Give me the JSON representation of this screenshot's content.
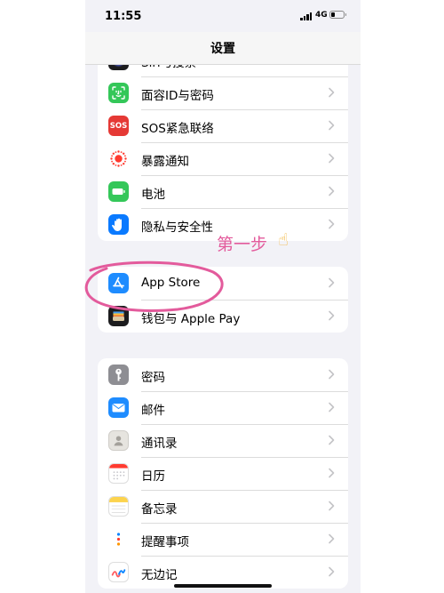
{
  "status": {
    "time": "11:55",
    "network": "4G"
  },
  "nav": {
    "title": "设置"
  },
  "group1": {
    "items": [
      {
        "label": "Siri与搜索"
      },
      {
        "label": "面容ID与密码"
      },
      {
        "label": "SOS紧急联络",
        "icon_text": "SOS"
      },
      {
        "label": "暴露通知"
      },
      {
        "label": "电池"
      },
      {
        "label": "隐私与安全性"
      }
    ]
  },
  "group2": {
    "items": [
      {
        "label": "App Store"
      },
      {
        "label": "钱包与 Apple Pay"
      }
    ]
  },
  "group3": {
    "items": [
      {
        "label": "密码"
      },
      {
        "label": "邮件"
      },
      {
        "label": "通讯录"
      },
      {
        "label": "日历"
      },
      {
        "label": "备忘录"
      },
      {
        "label": "提醒事项"
      },
      {
        "label": "无边记"
      }
    ]
  },
  "annotation": {
    "text": "第一步",
    "emoji": "☝"
  },
  "colors": {
    "annotation": "#e35b9c",
    "chevron": "#c4c4c7",
    "background": "#f2f2f7"
  }
}
